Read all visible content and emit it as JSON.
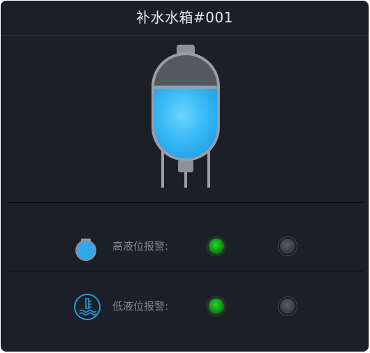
{
  "window": {
    "title": "补水水箱#001"
  },
  "tank": {
    "icon": "water-tank",
    "fill_level": 0.7,
    "water_color": "#2fb2f5",
    "body_color": "#9a9ea4"
  },
  "alarms": [
    {
      "label": "高液位报警:",
      "icon": "flask-icon",
      "indicator_on": "green",
      "indicator_off": "grey"
    },
    {
      "label": "低液位报警:",
      "icon": "thermometer-water-icon",
      "indicator_on": "green",
      "indicator_off": "grey"
    }
  ],
  "colors": {
    "background": "#1b1f27",
    "accent": "#2fb2f5",
    "led_green": "#16b016",
    "led_grey": "#3b3e43"
  }
}
